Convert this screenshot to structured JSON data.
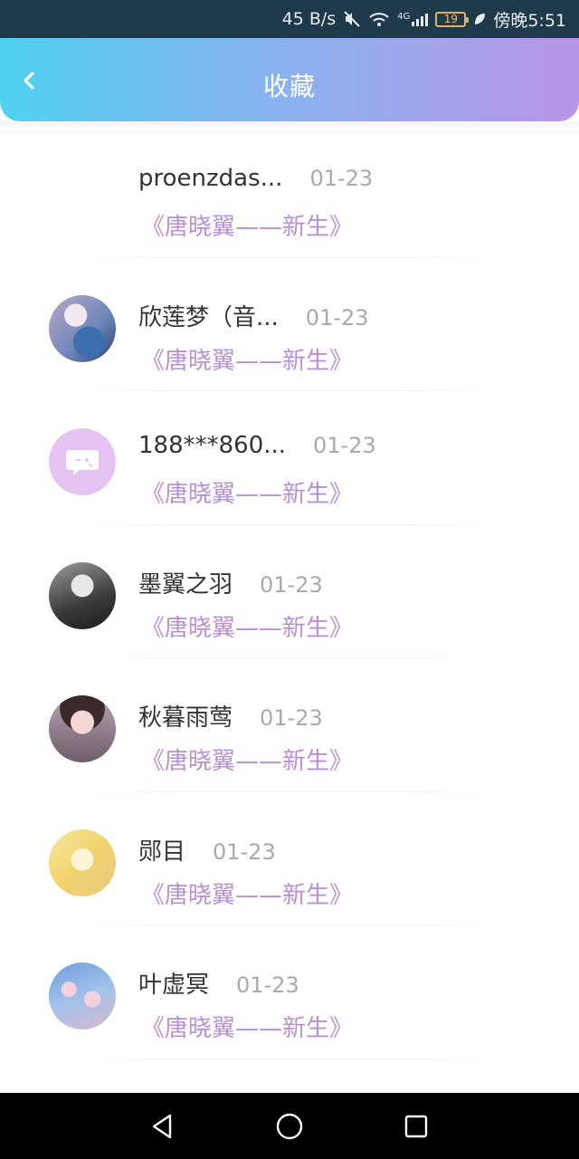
{
  "status_bar": {
    "speed": "45 B/s",
    "network": "4G",
    "battery": "19",
    "time": "傍晚5:51"
  },
  "header": {
    "title": "收藏"
  },
  "favorites": [
    {
      "username": "proenzdas...",
      "date": "01-23",
      "title": "《唐晓翼——新生》"
    },
    {
      "username": "欣莲梦（音...",
      "date": "01-23",
      "title": "《唐晓翼——新生》"
    },
    {
      "username": "188***860...",
      "date": "01-23",
      "title": "《唐晓翼——新生》"
    },
    {
      "username": "墨翼之羽",
      "date": "01-23",
      "title": "《唐晓翼——新生》"
    },
    {
      "username": "秋暮雨莺",
      "date": "01-23",
      "title": "《唐晓翼——新生》"
    },
    {
      "username": "郧目",
      "date": "01-23",
      "title": "《唐晓翼——新生》"
    },
    {
      "username": "叶虚冥",
      "date": "01-23",
      "title": "《唐晓翼——新生》"
    }
  ],
  "colors": {
    "header_gradient_start": "#4fd1f0",
    "header_gradient_end": "#b895e8",
    "title_purple": "#b98fd3",
    "status_bar_bg": "#1f3a4a"
  },
  "icons": {
    "back": "chevron-left-icon",
    "nav_back": "triangle-back-icon",
    "nav_home": "circle-home-icon",
    "nav_recent": "square-recent-icon"
  }
}
